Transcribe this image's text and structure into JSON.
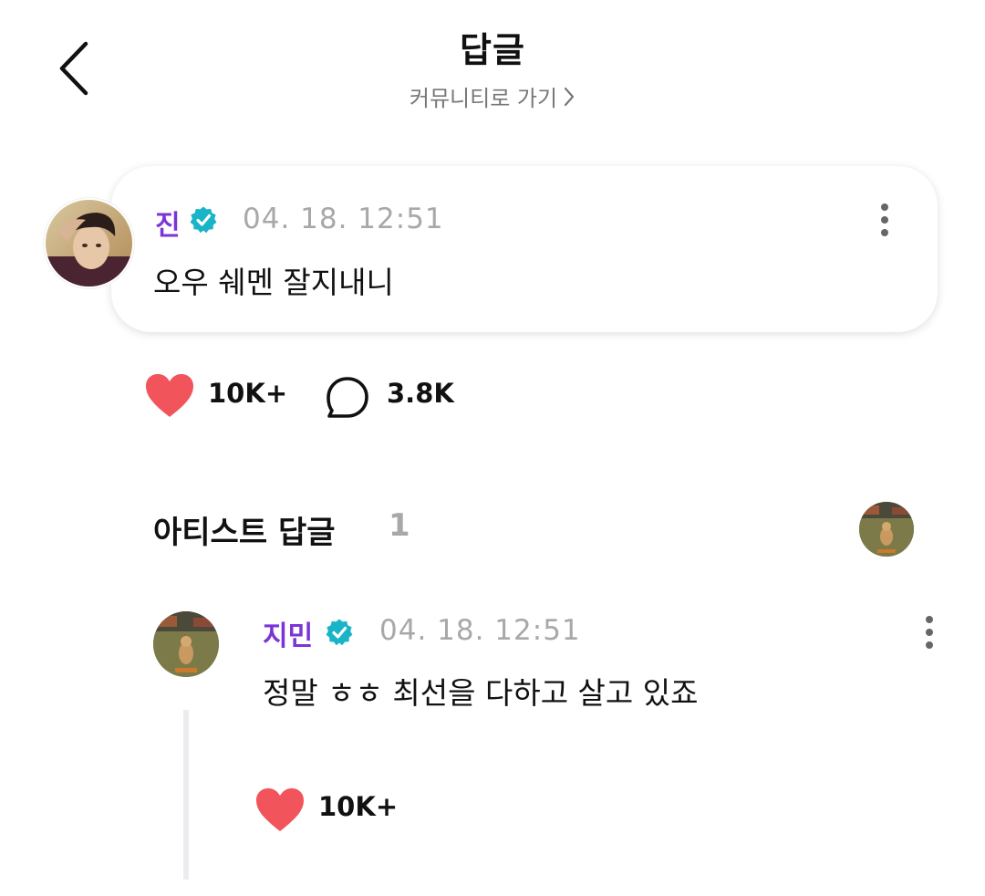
{
  "header": {
    "title": "답글",
    "community_link": "커뮤니티로 가기"
  },
  "post": {
    "author": "진",
    "timestamp": "04. 18. 12:51",
    "text": "오우 쉐멘 잘지내니",
    "likes": "10K+",
    "comments": "3.8K"
  },
  "artist_replies": {
    "title": "아티스트 답글",
    "count": "1"
  },
  "reply": {
    "author": "지민",
    "timestamp": "04. 18. 12:51",
    "text": "정말 ㅎㅎ 최선을 다하고 살고 있죠",
    "likes": "10K+"
  },
  "colors": {
    "author_purple": "#7b35d6",
    "verified_teal": "#19b4c8",
    "like_red": "#f2545b",
    "muted_gray": "#a8a8a8"
  },
  "icons": [
    "back-arrow-icon",
    "chevron-right-icon",
    "verified-badge-icon",
    "more-vertical-icon",
    "heart-icon",
    "comment-bubble-icon"
  ]
}
